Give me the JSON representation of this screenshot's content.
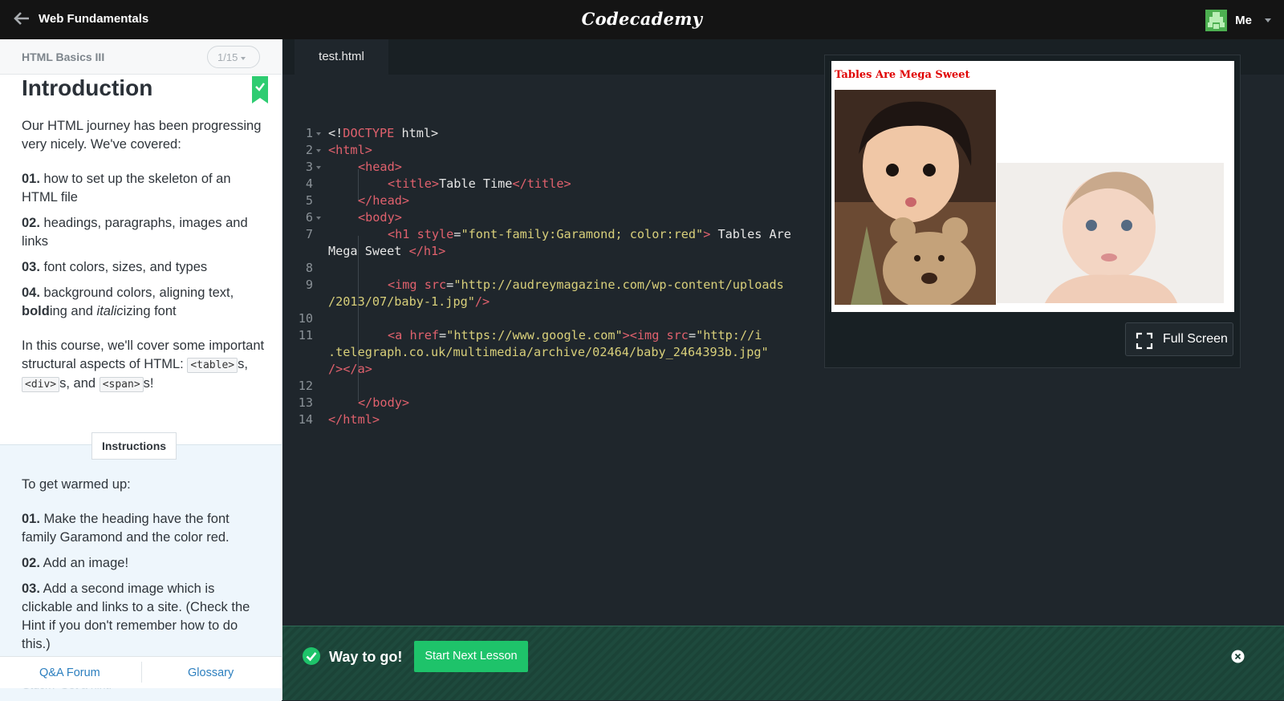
{
  "topbar": {
    "course_title": "Web Fundamentals",
    "brand": "Codecademy",
    "user_name": "Me"
  },
  "lesson": {
    "unit": "HTML Basics III",
    "pager": "1/15",
    "title": "Introduction",
    "intro": "Our HTML journey has been progressing very nicely. We've covered:",
    "covered": [
      {
        "num": "01.",
        "text": "how to set up the skeleton of an HTML file"
      },
      {
        "num": "02.",
        "text": "headings, paragraphs, images and links"
      },
      {
        "num": "03.",
        "text": "font colors, sizes, and types"
      }
    ],
    "item4": {
      "num": "04.",
      "text_a": "background colors, aligning text, ",
      "bold": "bold",
      "text_b": "ing and ",
      "italic": "italic",
      "text_c": "izing font"
    },
    "course_text": "In this course, we'll cover some important structural aspects of HTML:",
    "tags": {
      "table": "<table>",
      "div": "<div>",
      "span": "<span>",
      "s1": "s, ",
      "s2": "s, and ",
      "s3": "s!"
    },
    "instructions_label": "Instructions",
    "instructions_lead": "To get warmed up:",
    "steps": [
      {
        "num": "01.",
        "text": "Make the heading have the font family Garamond and the color red."
      },
      {
        "num": "02.",
        "text": "Add an image!"
      },
      {
        "num": "03.",
        "text": "Add a second image which is clickable and links to a site. (Check the Hint if you don't remember how to do this.)"
      }
    ],
    "links": {
      "forum": "Q&A Forum",
      "glossary": "Glossary"
    },
    "stuck": "Stuck? Get a hint!"
  },
  "editor": {
    "tab": "test.html",
    "line_numbers": [
      "1",
      "2",
      "3",
      "4",
      "5",
      "6",
      "7",
      "",
      "8",
      "9",
      "",
      "10",
      "11",
      "",
      "",
      "12",
      "13",
      "14"
    ],
    "code": {
      "l1_a": "<!",
      "l1_b": "DOCTYPE",
      "l1_c": " html>",
      "l2": "<html>",
      "l3": "<head>",
      "l4_a": "<title>",
      "l4_b": "Table Time",
      "l4_c": "</title>",
      "l5": "</head>",
      "l6": "<body>",
      "l7_a": "<h1 ",
      "l7_b": "style",
      "l7_c": "=",
      "l7_d": "\"font-family:Garamond; color:red\"",
      "l7_e": ">",
      "l7_f": " Tables Are",
      "l7_wrap": "Mega Sweet ",
      "l7_close": "</h1>",
      "l9_a": "<img ",
      "l9_b": "src",
      "l9_c": "=",
      "l9_d": "\"http://audreymagazine.com/wp-content/uploads",
      "l9_wrap": "/2013/07/baby-1.jpg\"",
      "l9_close": "/>",
      "l11_a": "<a ",
      "l11_b": "href",
      "l11_c": "=",
      "l11_d": "\"https://www.google.com\"",
      "l11_e": "><img ",
      "l11_f": "src",
      "l11_g": "=",
      "l11_h": "\"http://i",
      "l11_wrap1": ".telegraph.co.uk/multimedia/archive/02464/baby_2464393b.jpg\"",
      "l11_wrap2": "/></a>",
      "l13": "</body>",
      "l14": "</html>"
    }
  },
  "preview": {
    "heading": "Tables Are Mega Sweet",
    "fullscreen": "Full Screen"
  },
  "success": {
    "message": "Way to go!",
    "next_button": "Start Next Lesson"
  },
  "colors": {
    "accent_green": "#1ec36a",
    "preview_heading": "#e00000",
    "link_blue": "#2c7fbf"
  }
}
